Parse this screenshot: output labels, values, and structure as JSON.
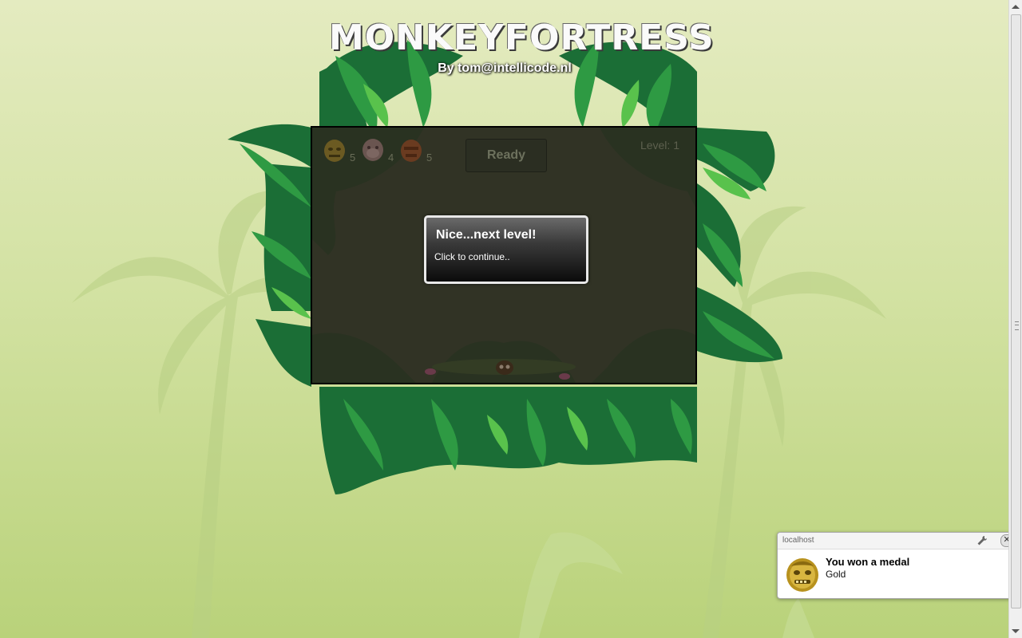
{
  "header": {
    "logo_text": "MONKEYFORTRESS",
    "byline": "By tom@intellicode.nl"
  },
  "game": {
    "hud": {
      "counts": [
        "5",
        "4",
        "5"
      ],
      "icons": [
        "gold-monkey-mask-icon",
        "pink-monkey-face-icon",
        "red-tiki-mask-icon"
      ],
      "ready_label": "Ready",
      "level_label": "Level: 1"
    },
    "dialog": {
      "title": "Nice...next level!",
      "body": "Click to continue.."
    }
  },
  "notification": {
    "origin": "localhost",
    "title": "You won a medal",
    "message": "Gold",
    "icons": [
      "wrench-icon",
      "close-icon",
      "gold-medal-icon"
    ]
  },
  "colors": {
    "background": "#d3e2a3",
    "leaf_dark": "#1d7a3a",
    "leaf_light": "#3fb24a",
    "game_frame": "#000000"
  }
}
